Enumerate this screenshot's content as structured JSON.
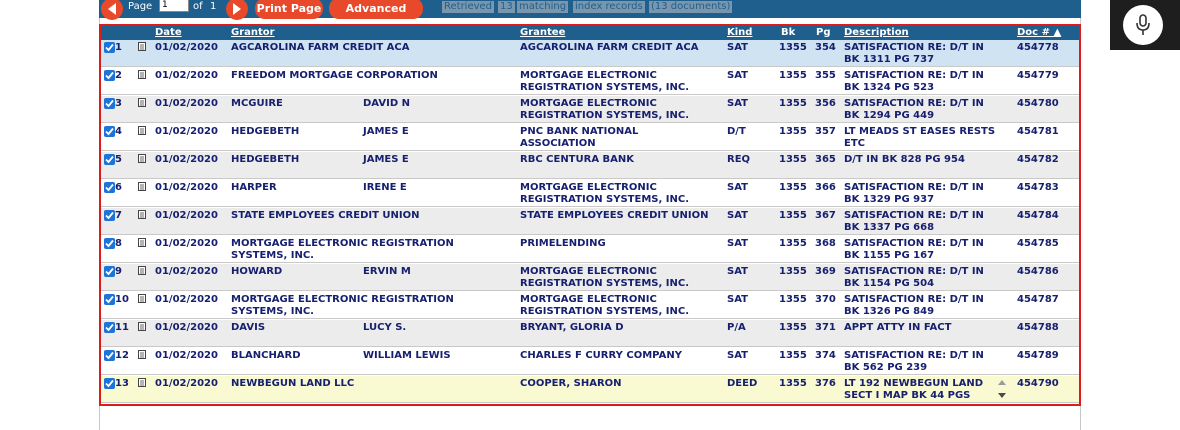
{
  "toolbar": {
    "page_label": "Page",
    "page_value": "1",
    "of_label": "of",
    "total_pages": "1",
    "print_page_label": "Print Page",
    "advanced_print_label": "Advanced Print",
    "status_retrieved": "Retrieved",
    "status_count": "13",
    "status_matching": "matching",
    "status_index_records": "index records",
    "status_documents": "(13 documents)"
  },
  "columns": {
    "date": "Date",
    "grantor": "Grantor",
    "grantee": "Grantee",
    "kind": "Kind",
    "bk": "Bk",
    "pg": "Pg",
    "description": "Description",
    "doc_num": "Doc # ▲"
  },
  "rows": [
    {
      "num": "1",
      "date": "01/02/2020",
      "grantor1": "AGCAROLINA FARM CREDIT ACA",
      "grantor2": "",
      "grantee1": "AGCAROLINA FARM CREDIT ACA",
      "grantee2": "",
      "kind": "SAT",
      "bk": "1355",
      "pg": "354",
      "desc1": "SATISFACTION RE: D/T IN",
      "desc2": "BK 1311 PG 737",
      "doc": "454778",
      "bg": "bg-sel"
    },
    {
      "num": "2",
      "date": "01/02/2020",
      "grantor1": "FREEDOM MORTGAGE CORPORATION",
      "grantor2": "",
      "grantee1": "MORTGAGE ELECTRONIC",
      "grantee2": "REGISTRATION SYSTEMS, INC.",
      "kind": "SAT",
      "bk": "1355",
      "pg": "355",
      "desc1": "SATISFACTION RE: D/T IN",
      "desc2": "BK 1324 PG 523",
      "doc": "454779",
      "bg": "bg-white"
    },
    {
      "num": "3",
      "date": "01/02/2020",
      "grantor1": "MCGUIRE",
      "grantor2": "DAVID N",
      "grantee1": "MORTGAGE ELECTRONIC",
      "grantee2": "REGISTRATION SYSTEMS, INC.",
      "kind": "SAT",
      "bk": "1355",
      "pg": "356",
      "desc1": "SATISFACTION RE: D/T IN",
      "desc2": "BK 1294 PG 449",
      "doc": "454780",
      "bg": "bg-gray"
    },
    {
      "num": "4",
      "date": "01/02/2020",
      "grantor1": "HEDGEBETH",
      "grantor2": "JAMES E",
      "grantee1": "PNC BANK NATIONAL",
      "grantee2": "ASSOCIATION",
      "kind": "D/T",
      "bk": "1355",
      "pg": "357",
      "desc1": "LT MEADS ST EASES RESTS",
      "desc2": "ETC",
      "doc": "454781",
      "bg": "bg-white"
    },
    {
      "num": "5",
      "date": "01/02/2020",
      "grantor1": "HEDGEBETH",
      "grantor2": "JAMES E",
      "grantee1": "RBC CENTURA BANK",
      "grantee2": "",
      "kind": "REQ",
      "bk": "1355",
      "pg": "365",
      "desc1": "D/T IN BK 828 PG 954",
      "desc2": "",
      "doc": "454782",
      "bg": "bg-gray"
    },
    {
      "num": "6",
      "date": "01/02/2020",
      "grantor1": "HARPER",
      "grantor2": "IRENE E",
      "grantee1": "MORTGAGE ELECTRONIC",
      "grantee2": "REGISTRATION SYSTEMS, INC.",
      "kind": "SAT",
      "bk": "1355",
      "pg": "366",
      "desc1": "SATISFACTION RE: D/T IN",
      "desc2": "BK 1329 PG 937",
      "doc": "454783",
      "bg": "bg-white"
    },
    {
      "num": "7",
      "date": "01/02/2020",
      "grantor1": "STATE EMPLOYEES CREDIT UNION",
      "grantor2": "",
      "grantee1": "STATE EMPLOYEES CREDIT UNION",
      "grantee2": "",
      "kind": "SAT",
      "bk": "1355",
      "pg": "367",
      "desc1": "SATISFACTION RE: D/T IN",
      "desc2": "BK 1337 PG 668",
      "doc": "454784",
      "bg": "bg-gray"
    },
    {
      "num": "8",
      "date": "01/02/2020",
      "grantor1": "MORTGAGE ELECTRONIC REGISTRATION",
      "grantor2": "SYSTEMS, INC.",
      "grantee1": "PRIMELENDING",
      "grantee2": "",
      "kind": "SAT",
      "bk": "1355",
      "pg": "368",
      "desc1": "SATISFACTION RE: D/T IN",
      "desc2": "BK 1155 PG 167",
      "doc": "454785",
      "bg": "bg-white"
    },
    {
      "num": "9",
      "date": "01/02/2020",
      "grantor1": "HOWARD",
      "grantor2": "ERVIN M",
      "grantee1": "MORTGAGE ELECTRONIC",
      "grantee2": "REGISTRATION SYSTEMS, INC.",
      "kind": "SAT",
      "bk": "1355",
      "pg": "369",
      "desc1": "SATISFACTION RE: D/T IN",
      "desc2": "BK 1154 PG 504",
      "doc": "454786",
      "bg": "bg-gray"
    },
    {
      "num": "10",
      "date": "01/02/2020",
      "grantor1": "MORTGAGE ELECTRONIC REGISTRATION",
      "grantor2": "SYSTEMS, INC.",
      "grantee1": "MORTGAGE ELECTRONIC",
      "grantee2": "REGISTRATION SYSTEMS, INC.",
      "kind": "SAT",
      "bk": "1355",
      "pg": "370",
      "desc1": "SATISFACTION RE: D/T IN",
      "desc2": "BK 1326 PG 849",
      "doc": "454787",
      "bg": "bg-white"
    },
    {
      "num": "11",
      "date": "01/02/2020",
      "grantor1": "DAVIS",
      "grantor2": "LUCY S.",
      "grantee1": "BRYANT, GLORIA D",
      "grantee2": "",
      "kind": "P/A",
      "bk": "1355",
      "pg": "371",
      "desc1": "APPT ATTY IN FACT",
      "desc2": "",
      "doc": "454788",
      "bg": "bg-gray"
    },
    {
      "num": "12",
      "date": "01/02/2020",
      "grantor1": "BLANCHARD",
      "grantor2": "WILLIAM LEWIS",
      "grantee1": "CHARLES F CURRY COMPANY",
      "grantee2": "",
      "kind": "SAT",
      "bk": "1355",
      "pg": "374",
      "desc1": "SATISFACTION RE: D/T IN",
      "desc2": "BK 562 PG 239",
      "doc": "454789",
      "bg": "bg-white"
    },
    {
      "num": "13",
      "date": "01/02/2020",
      "grantor1": "NEWBEGUN LAND LLC",
      "grantor2": "",
      "grantee1": "COOPER, SHARON",
      "grantee2": "",
      "kind": "DEED",
      "bk": "1355",
      "pg": "376",
      "desc1": "LT 192 NEWBEGUN LAND",
      "desc2": "SECT I MAP BK 44 PGS",
      "doc": "454790",
      "bg": "bg-yellow"
    }
  ],
  "colors": {
    "toolbar_bg": "#1f5f8e",
    "button_red": "#e8492a",
    "row_text": "#17206f",
    "selected_row": "#cfe3f2",
    "highlight_row": "#fafad2",
    "results_border": "#dd1b1b"
  },
  "icons": {
    "prev": "triangle-left-icon",
    "next": "triangle-right-icon",
    "row_document": "document-icon",
    "checkbox": "checkmark-icon",
    "voice": "microphone-icon"
  }
}
